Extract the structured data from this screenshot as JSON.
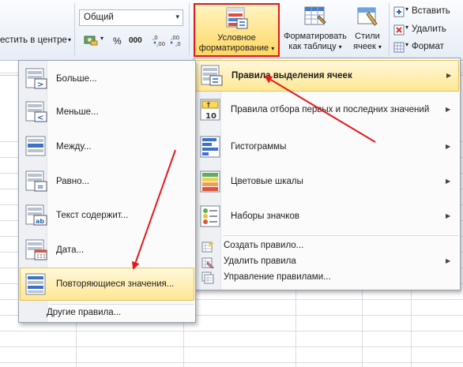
{
  "ribbon": {
    "merge_center": "естить в центре",
    "number_format": "Общий",
    "percent_symbol": "%",
    "thousands_symbol": "000",
    "conditional_formatting": [
      "Условное",
      "форматирование"
    ],
    "format_as_table": [
      "Форматировать",
      "как таблицу"
    ],
    "cell_styles": [
      "Стили",
      "ячеек"
    ],
    "insert": "Вставить",
    "delete": "Удалить",
    "format": "Формат"
  },
  "cf_menu": {
    "items": [
      {
        "label": "Правила выделения ячеек",
        "icon": "highlight-cells-rules-icon"
      },
      {
        "label": "Правила отбора первых и последних значений",
        "icon": "top-bottom-rules-icon"
      },
      {
        "label": "Гистограммы",
        "icon": "data-bars-icon"
      },
      {
        "label": "Цветовые шкалы",
        "icon": "color-scales-icon"
      },
      {
        "label": "Наборы значков",
        "icon": "icon-sets-icon"
      }
    ],
    "small_items": [
      {
        "label": "Создать правило...",
        "icon": "new-rule-icon"
      },
      {
        "label": "Удалить правила",
        "icon": "clear-rules-icon"
      },
      {
        "label": "Управление правилами...",
        "icon": "manage-rules-icon"
      }
    ]
  },
  "highlight_submenu": {
    "items": [
      {
        "label": "Больше...",
        "icon": "greater-than-icon"
      },
      {
        "label": "Меньше...",
        "icon": "less-than-icon"
      },
      {
        "label": "Между...",
        "icon": "between-icon"
      },
      {
        "label": "Равно...",
        "icon": "equal-to-icon"
      },
      {
        "label": "Текст содержит...",
        "icon": "text-contains-icon"
      },
      {
        "label": "Дата...",
        "icon": "date-occurring-icon"
      },
      {
        "label": "Повторяющиеся значения...",
        "icon": "duplicate-values-icon"
      }
    ],
    "more_rules": "Другие правила..."
  },
  "colors": {
    "highlight_red": "#e01818",
    "arrow_red": "#e3191c",
    "menu_highlight": "#ffe794"
  }
}
